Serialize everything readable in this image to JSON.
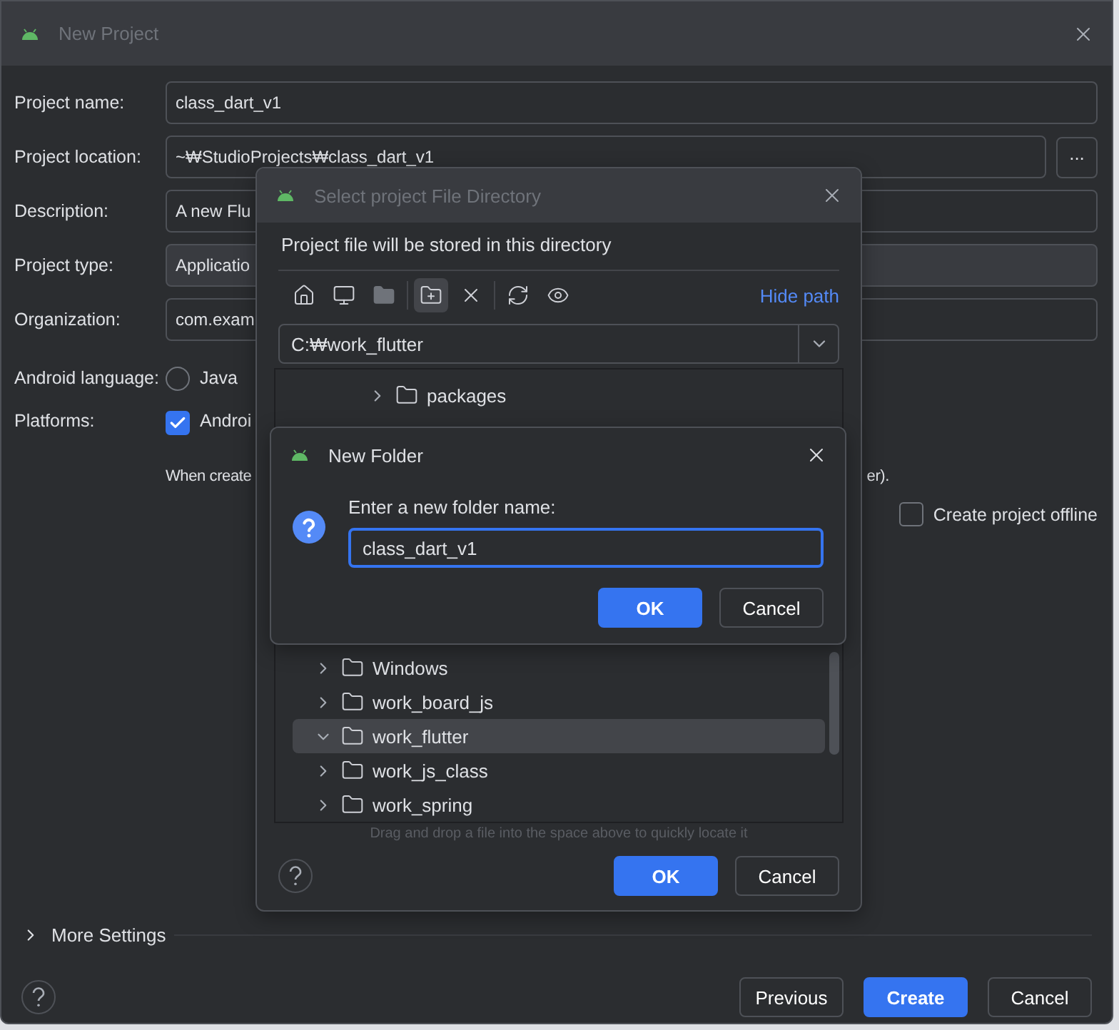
{
  "main_window": {
    "title": "New Project",
    "fields": [
      {
        "label": "Project name:",
        "value": "class_dart_v1",
        "kind": "text"
      },
      {
        "label": "Project location:",
        "value": "~₩StudioProjects₩class_dart_v1",
        "kind": "browse",
        "button": "..."
      },
      {
        "label": "Description:",
        "value": "A new Flu",
        "kind": "text"
      },
      {
        "label": "Project type:",
        "value": "Applicatio",
        "kind": "dropdown"
      },
      {
        "label": "Organization:",
        "value": "com.exam",
        "kind": "text"
      }
    ],
    "android_language": {
      "label": "Android language:",
      "options": [
        {
          "label": "Java",
          "selected": false
        }
      ]
    },
    "platforms": {
      "label": "Platforms:",
      "options": [
        {
          "label": "Androi",
          "checked": true
        }
      ]
    },
    "note_fragments": [
      "When create",
      "er)."
    ],
    "offline": {
      "label": "Create project offline",
      "checked": false
    },
    "more_settings": {
      "label": "More Settings",
      "expanded": false
    },
    "buttons": [
      {
        "label": "Previous",
        "primary": false
      },
      {
        "label": "Create",
        "primary": true
      },
      {
        "label": "Cancel",
        "primary": false
      }
    ]
  },
  "directory_dialog": {
    "title": "Select project File Directory",
    "description": "Project file will be stored in this directory",
    "toolbar": [
      {
        "kind": "home",
        "selected": false,
        "disabled": false
      },
      {
        "kind": "desktop",
        "selected": false,
        "disabled": false
      },
      {
        "kind": "project",
        "selected": false,
        "disabled": true
      },
      {
        "kind": "new-folder",
        "selected": true,
        "disabled": false
      },
      {
        "kind": "delete",
        "selected": false,
        "disabled": false
      },
      {
        "kind": "refresh",
        "selected": false,
        "disabled": false
      },
      {
        "kind": "hidden-files",
        "selected": false,
        "disabled": false
      }
    ],
    "hide_path": "Hide path",
    "path": "C:₩work_flutter",
    "tree_top": [
      {
        "children": [
          {
            "children": [
              {
                "children": [
                  {
                    "name": "packages",
                    "expanded": false,
                    "selected": false
                  }
                ]
              }
            ]
          }
        ]
      }
    ],
    "tree_bottom": [
      {
        "children": [
          {
            "name": "Windows",
            "expanded": false,
            "selected": false
          },
          {
            "name": "work_board_js",
            "expanded": false,
            "selected": false
          },
          {
            "name": "work_flutter",
            "expanded": true,
            "selected": true
          },
          {
            "name": "work_js_class",
            "expanded": false,
            "selected": false
          },
          {
            "name": "work_spring",
            "expanded": false,
            "selected": false
          }
        ]
      }
    ],
    "hint": "Drag and drop a file into the space above to quickly locate it",
    "buttons": [
      {
        "label": "OK",
        "primary": true
      },
      {
        "label": "Cancel",
        "primary": false
      }
    ]
  },
  "new_folder_dialog": {
    "title": "New Folder",
    "prompt": "Enter a new folder name:",
    "value": "class_dart_v1",
    "buttons": [
      {
        "label": "OK",
        "primary": true
      },
      {
        "label": "Cancel",
        "primary": false
      }
    ]
  }
}
